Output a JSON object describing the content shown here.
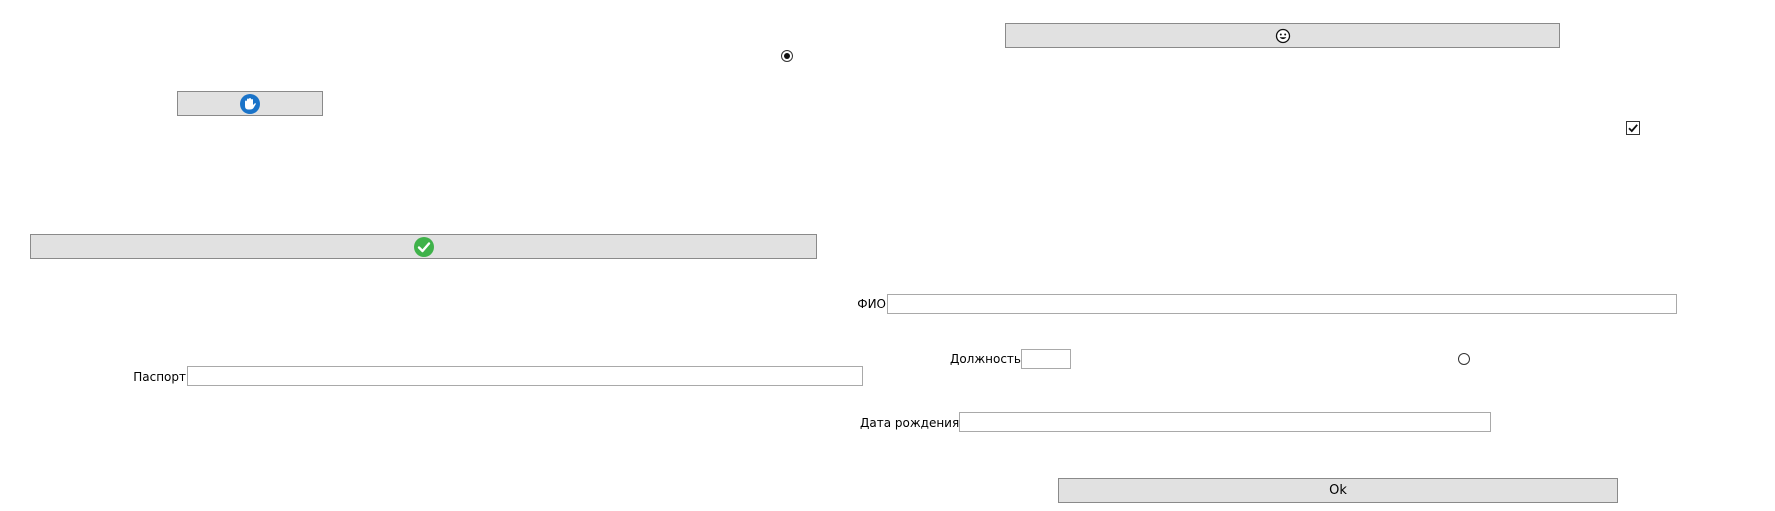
{
  "buttons": {
    "top_right_icon": "face-icon",
    "top_left_icon": "hand-icon",
    "wide_icon": "checkmark-icon",
    "ok_label": "Ok"
  },
  "radio_top": {
    "checked": true
  },
  "radio_right": {
    "checked": false
  },
  "checkbox": {
    "checked": true
  },
  "fields": {
    "fio": {
      "label": "ФИО",
      "value": ""
    },
    "position": {
      "label": "Должность",
      "value": ""
    },
    "birth_date": {
      "label": "Дата рождения",
      "value": ""
    },
    "passport": {
      "label": "Паспорт",
      "value": ""
    }
  },
  "colors": {
    "button_bg": "#e1e1e1",
    "hand_icon": "#1a73c8",
    "check_icon": "#3fb24a"
  }
}
